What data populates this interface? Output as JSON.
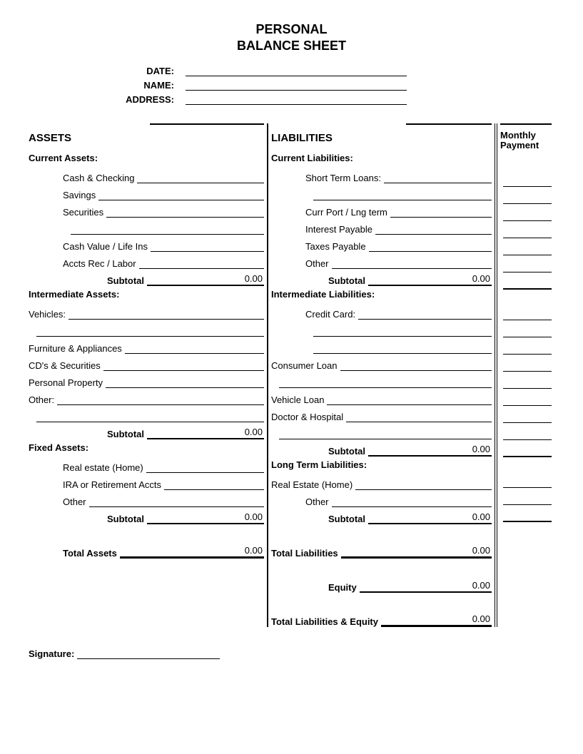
{
  "title_line1": "PERSONAL",
  "title_line2": "BALANCE SHEET",
  "header": {
    "date": "DATE:",
    "name": "NAME:",
    "address": "ADDRESS:"
  },
  "assets": {
    "heading": "ASSETS",
    "current": {
      "heading": "Current Assets:",
      "cash": "Cash & Checking",
      "savings": "Savings",
      "securities": "Securities",
      "cashvalue": "Cash Value / Life Ins",
      "accts": "Accts Rec / Labor",
      "subtotal_label": "Subtotal",
      "subtotal_value": "0.00"
    },
    "intermediate": {
      "heading": "Intermediate Assets:",
      "vehicles": "Vehicles:",
      "furniture": "Furniture & Appliances",
      "cds": "CD's & Securities",
      "personal": "Personal Property",
      "other": "Other:",
      "subtotal_label": "Subtotal",
      "subtotal_value": "0.00"
    },
    "fixed": {
      "heading": "Fixed Assets:",
      "realestate": "Real estate (Home)",
      "ira": "IRA or Retirement Accts",
      "other": "Other",
      "subtotal_label": "Subtotal",
      "subtotal_value": "0.00"
    },
    "total_label": "Total Assets",
    "total_value": "0.00"
  },
  "liabilities": {
    "heading": "LIABILITIES",
    "current": {
      "heading": "Current Liabilities:",
      "short": "Short Term Loans:",
      "curr": "Curr Port / Lng term",
      "interest": "Interest Payable",
      "taxes": "Taxes Payable",
      "other": "Other",
      "subtotal_label": "Subtotal",
      "subtotal_value": "0.00"
    },
    "intermediate": {
      "heading": "Intermediate Liabilities:",
      "credit": "Credit  Card:",
      "consumer": "Consumer Loan",
      "vehicle": "Vehicle Loan",
      "doctor": "Doctor & Hospital",
      "subtotal_label": "Subtotal",
      "subtotal_value": "0.00"
    },
    "longterm": {
      "heading": "Long Term Liabilities:",
      "realestate": "Real Estate (Home)",
      "other": "Other",
      "subtotal_label": "Subtotal",
      "subtotal_value": "0.00"
    },
    "total_label": "Total Liabilities",
    "total_value": "0.00",
    "equity_label": "Equity",
    "equity_value": "0.00",
    "total_le_label": "Total Liabilities & Equity",
    "total_le_value": "0.00"
  },
  "monthly_payment_heading": "Monthly Payment",
  "signature_label": "Signature:"
}
